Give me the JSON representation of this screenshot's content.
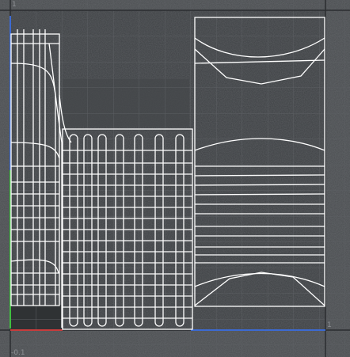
{
  "viewport": {
    "axis_labels": {
      "top_left_v": "1",
      "bottom_right_u": "1",
      "bottom_left_v": "-0.1"
    },
    "colors": {
      "background": "#4a4d50",
      "grid_minor": "#5a5d61",
      "grid_major": "#2b2d30",
      "wireframe": "#ffffff",
      "axis_u": "#c83c3c",
      "axis_v": "#3c6ad2",
      "axis_green": "#3fbf3f"
    }
  }
}
